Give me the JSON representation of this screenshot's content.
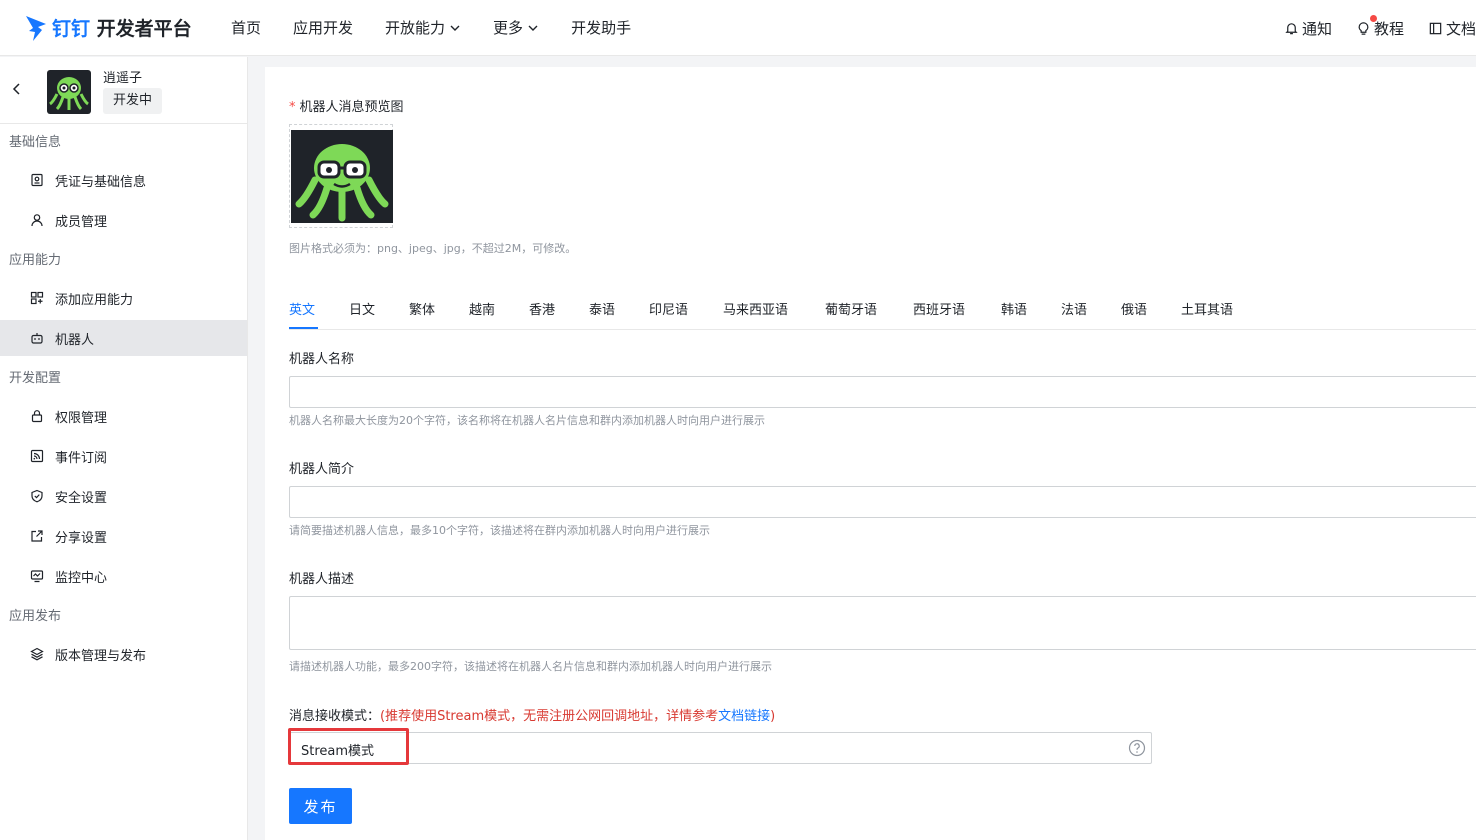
{
  "header": {
    "logo_brand": "钉钉",
    "logo_suffix": "开发者平台",
    "nav": [
      {
        "label": "首页"
      },
      {
        "label": "应用开发"
      },
      {
        "label": "开放能力"
      },
      {
        "label": "更多"
      },
      {
        "label": "开发助手"
      }
    ],
    "right": {
      "notify": "通知",
      "tutorial": "教程",
      "docs": "文档"
    }
  },
  "sidebar": {
    "app_name": "逍遥子",
    "app_status": "开发中",
    "groups": [
      {
        "title": "基础信息",
        "items": [
          {
            "label": "凭证与基础信息",
            "icon": "credential-icon"
          },
          {
            "label": "成员管理",
            "icon": "user-icon"
          }
        ]
      },
      {
        "title": "应用能力",
        "items": [
          {
            "label": "添加应用能力",
            "icon": "apps-add-icon"
          },
          {
            "label": "机器人",
            "icon": "robot-icon"
          }
        ]
      },
      {
        "title": "开发配置",
        "items": [
          {
            "label": "权限管理",
            "icon": "lock-icon"
          },
          {
            "label": "事件订阅",
            "icon": "rss-icon"
          },
          {
            "label": "安全设置",
            "icon": "shield-icon"
          },
          {
            "label": "分享设置",
            "icon": "share-icon"
          },
          {
            "label": "监控中心",
            "icon": "monitor-icon"
          }
        ]
      },
      {
        "title": "应用发布",
        "items": [
          {
            "label": "版本管理与发布",
            "icon": "layers-icon"
          }
        ]
      }
    ],
    "active_item": "机器人"
  },
  "form": {
    "preview_label": "机器人消息预览图",
    "preview_required_mark": "*",
    "preview_hint": "图片格式必须为：png、jpeg、jpg，不超过2M，可修改。",
    "languages": [
      "英文",
      "日文",
      "繁体",
      "越南",
      "香港",
      "泰语",
      "印尼语",
      "马来西亚语",
      "葡萄牙语",
      "西班牙语",
      "韩语",
      "法语",
      "俄语",
      "土耳其语"
    ],
    "active_language": "英文",
    "name_label": "机器人名称",
    "name_value": "",
    "name_hint": "机器人名称最大长度为20个字符，该名称将在机器人名片信息和群内添加机器人时向用户进行展示",
    "intro_label": "机器人简介",
    "intro_value": "",
    "intro_hint": "请简要描述机器人信息，最多10个字符，该描述将在群内添加机器人时向用户进行展示",
    "desc_label": "机器人描述",
    "desc_value": "",
    "desc_hint": "请描述机器人功能，最多200字符，该描述将在机器人名片信息和群内添加机器人时向用户进行展示",
    "mode_label": "消息接收模式：",
    "mode_note_prefix": "(推荐使用Stream模式，无需注册公网回调地址，详情参考",
    "mode_note_link": "文档链接",
    "mode_note_suffix": ")",
    "mode_value": "Stream模式",
    "publish_label": "发布"
  },
  "colors": {
    "accent": "#1677ff",
    "required": "#f54a45",
    "highlight": "#e5383b",
    "note": "#d83931"
  }
}
